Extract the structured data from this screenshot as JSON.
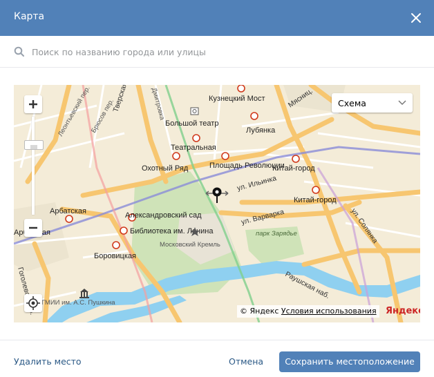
{
  "dialog": {
    "title": "Карта",
    "close_icon": "close-icon"
  },
  "search": {
    "placeholder": "Поиск по названию города или улицы",
    "value": ""
  },
  "map": {
    "layer_selector": "Схема",
    "copyright": "© Яндекс",
    "terms_link": "Условия использования",
    "provider_logo": "Яндекс",
    "metro_stations": [
      "Кузнецкий Мост",
      "Лубянка",
      "Театральная",
      "Охотный Ряд",
      "Площадь Революции",
      "Китай-город",
      "Китай-город",
      "Арбатская",
      "Арбатская",
      "Александровский сад",
      "Библиотека им. Ленина",
      "Боровицкая"
    ],
    "places": [
      "Большой театр",
      "Московский Кремль",
      "парк Зарядье",
      "ГМИИ им. А.С. Пушкина"
    ],
    "streets": [
      "Тверская ул.",
      "ул. Ильинка",
      "ул. Варварка",
      "ул. Солянка",
      "Раушская наб.",
      "Мясниц.",
      "Леонтьевский пер.",
      "Брюсов пер.",
      "Гоголевский б.",
      "Дмитровка"
    ]
  },
  "footer": {
    "delete_label": "Удалить место",
    "cancel_label": "Отмена",
    "save_label": "Сохранить местоположение"
  },
  "colors": {
    "header": "#5181b8",
    "link": "#2a5885",
    "river": "#8fd0f0",
    "park": "#cfe3b8"
  }
}
